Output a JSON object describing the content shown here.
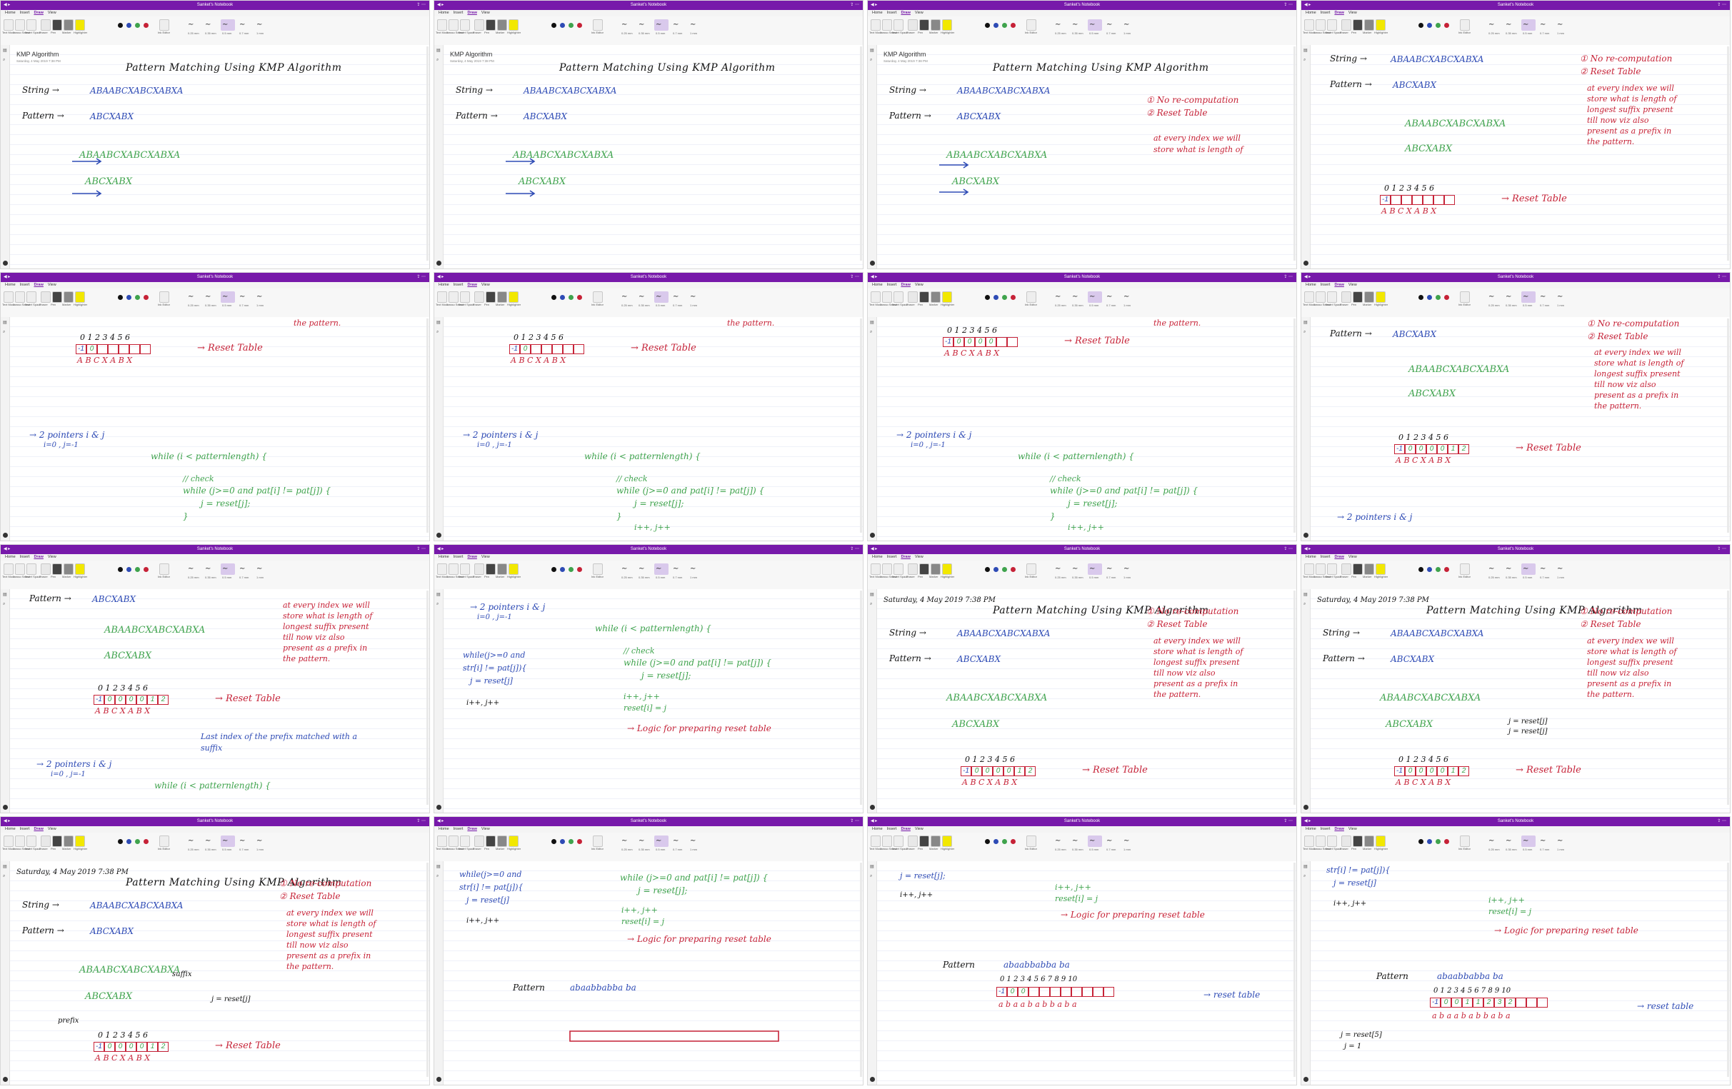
{
  "window": {
    "title": "Sanket's Notebook",
    "menu": [
      "Home",
      "Insert",
      "Draw",
      "View"
    ],
    "active_menu": "Draw",
    "ribbon_buttons": [
      "Text Mode",
      "Lasso Select",
      "Insert Space",
      "Eraser",
      "Pen",
      "Marker",
      "Highlighter",
      "Ink Editor"
    ],
    "stroke_sizes": [
      "0.25 mm",
      "0.35 mm",
      "0.5 mm",
      "0.7 mm",
      "1 mm"
    ],
    "pen_colors": [
      "#111111",
      "#2e4bb5",
      "#3fa34d",
      "#c62237"
    ],
    "accent": "#7719aa"
  },
  "page": {
    "title": "KMP Algorithm",
    "date": "Saturday, 4 May 2019    7:38 PM"
  },
  "notes": {
    "heading": "Pattern Matching Using KMP Algorithm",
    "string_label": "String →",
    "string_value": "ABAABCXABCXABXA",
    "pattern_label": "Pattern →",
    "pattern_value": "ABCXABX",
    "green_string": "ABAABCXABCXABXA",
    "green_pattern": "ABCXABX",
    "point1": "① No re-computation",
    "point2": "② Reset Table",
    "explain": [
      "at every index we will",
      "store what is length of",
      "longest suffix present",
      "till now viz also",
      "present as a prefix in",
      "the pattern."
    ],
    "index_row": "0 1 2 3 4 5 6",
    "letters_row": "A B C X A B X",
    "reset_table_label": "→ Reset Table",
    "pointers": "→ 2 pointers i & j",
    "pointers_init": "i=0 , j=-1",
    "while_loop": "while (i < patternlength) {",
    "check_comment": "// check",
    "while_inner": "while (j>=0 and pat[i] != pat[j]) {",
    "reset_assign": "j = reset[j];",
    "close_brace": "}",
    "incr": "i++, j++",
    "reset_i": "reset[i] = j",
    "logic_note": "→ Logic for preparing reset table",
    "last_index_note": [
      "Last index of the prefix matched with a",
      "suffix"
    ],
    "side_while": "while(j>=0 and",
    "side_str": "str[i] != pat[j]){",
    "j_reset_a": "j = reset[j]",
    "j_reset_b": "j = reset[j]",
    "suffix_lbl": "suffix",
    "prefix_lbl": "prefix",
    "pattern2_label": "Pattern",
    "pattern2_value": "abaabbabba ba",
    "pattern2_letters": "a b a a b a b b a b a",
    "index_row2": "0 1 2 3 4 5 6 7 8 9 10",
    "reset_table_short": "→ reset table",
    "j_reset5": "j = reset[5]",
    "j_eq1": "j = 1"
  },
  "tables": {
    "initial": [
      "-1",
      "",
      "",
      "",
      "",
      "",
      ""
    ],
    "step1": [
      "-1",
      "0",
      "",
      "",
      "",
      "",
      ""
    ],
    "step2": [
      "-1",
      "0",
      "0",
      "0",
      "0",
      "",
      ""
    ],
    "full": [
      "-1",
      "0",
      "0",
      "0",
      "0",
      "1",
      "2"
    ],
    "p2_partial": [
      "-1",
      "0",
      "0",
      "",
      "",
      "",
      "",
      "",
      "",
      "",
      ""
    ],
    "p2_more": [
      "-1",
      "0",
      "0",
      "1",
      "1",
      "2",
      "3",
      "2",
      "",
      "",
      ""
    ]
  }
}
